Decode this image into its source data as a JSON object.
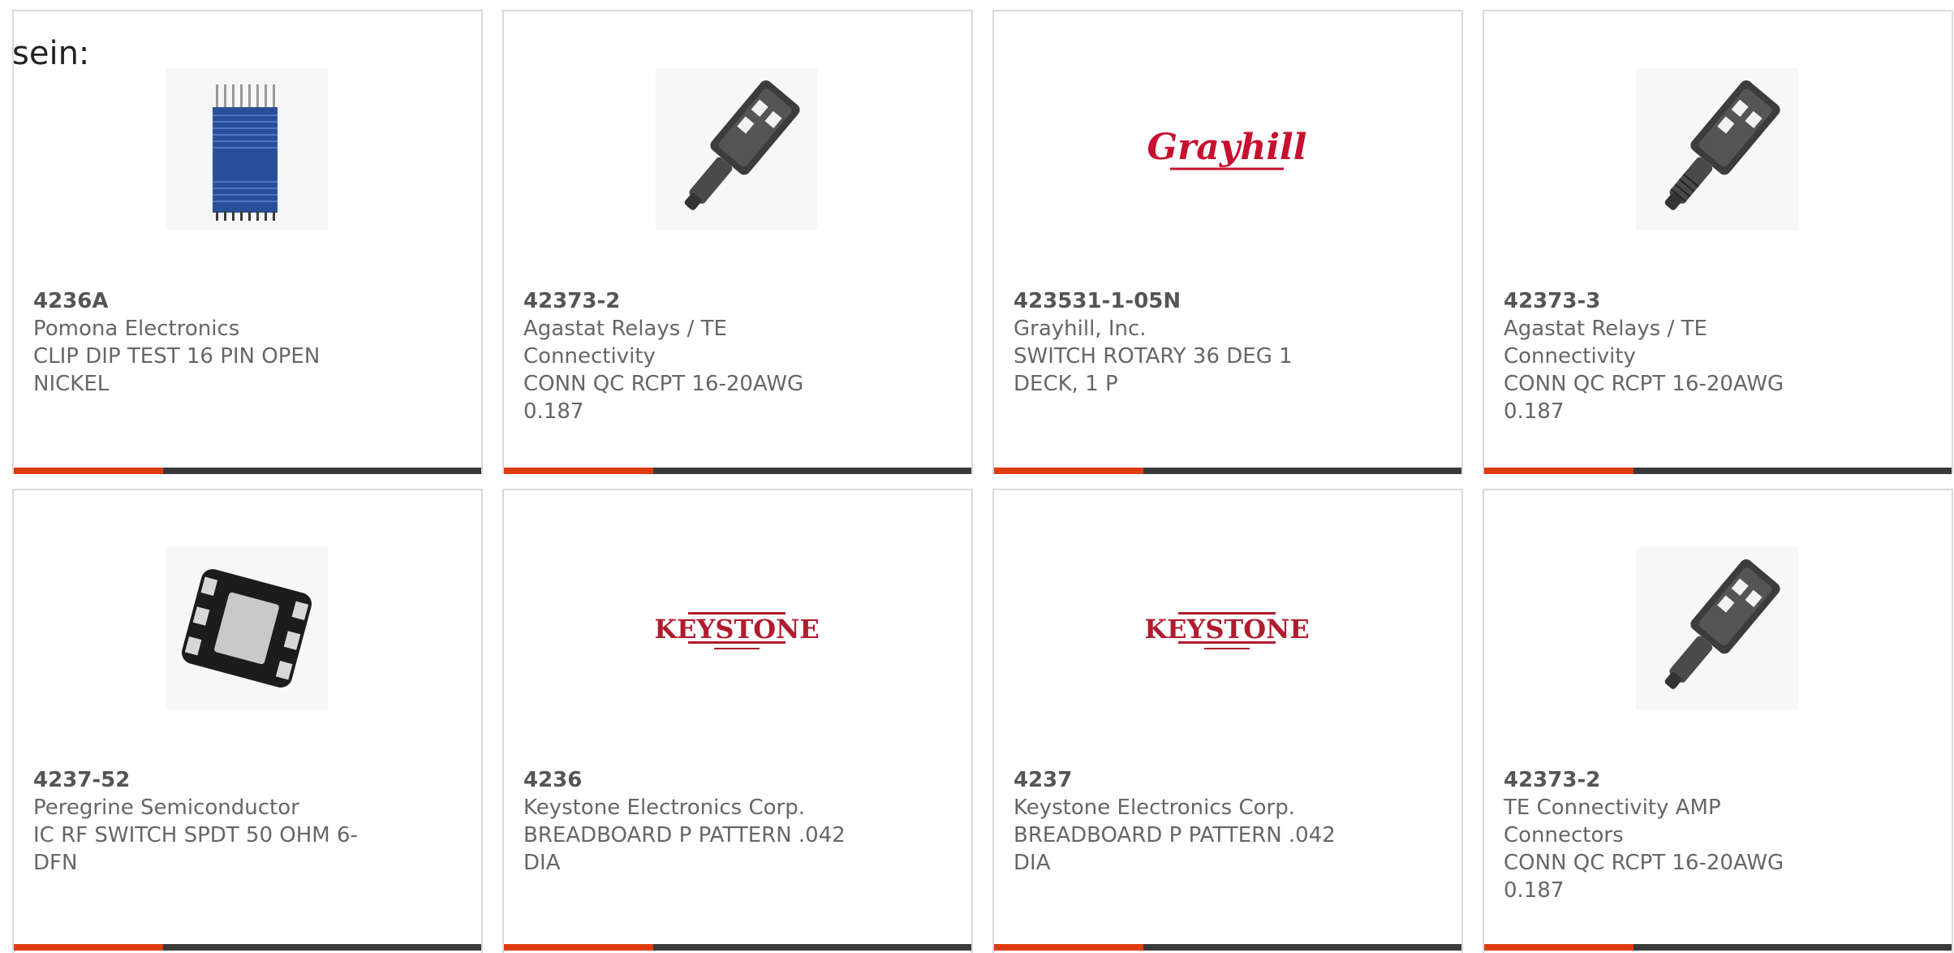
{
  "intro_text": "sein:",
  "colors": {
    "accent": "#e03c12",
    "bar_dark": "#3a3a3a",
    "text": "#666666"
  },
  "products": [
    {
      "part_number": "4236A",
      "manufacturer": "Pomona Electronics",
      "description": "CLIP DIP TEST 16 PIN OPEN NICKEL",
      "image": "dip-test-clip-icon"
    },
    {
      "part_number": "42373-2",
      "manufacturer": "Agastat Relays / TE Connectivity",
      "description": "CONN QC RCPT 16-20AWG 0.187",
      "image": "quick-connect-receptacle-icon"
    },
    {
      "part_number": "423531-1-05N",
      "manufacturer": "Grayhill, Inc.",
      "description": "SWITCH ROTARY 36 DEG 1 DECK, 1 P",
      "image": "grayhill-logo",
      "logo_text": "Grayhill"
    },
    {
      "part_number": "42373-3",
      "manufacturer": "Agastat Relays / TE Connectivity",
      "description": "CONN QC RCPT 16-20AWG 0.187",
      "image": "quick-connect-receptacle-icon"
    },
    {
      "part_number": "4237-52",
      "manufacturer": "Peregrine Semiconductor",
      "description": "IC RF SWITCH SPDT 50 OHM 6-DFN",
      "image": "dfn-chip-icon"
    },
    {
      "part_number": "4236",
      "manufacturer": "Keystone Electronics Corp.",
      "description": "BREADBOARD P PATTERN .042 DIA",
      "image": "keystone-logo",
      "logo_text": "KEYSTONE"
    },
    {
      "part_number": "4237",
      "manufacturer": "Keystone Electronics Corp.",
      "description": "BREADBOARD P PATTERN .042 DIA",
      "image": "keystone-logo",
      "logo_text": "KEYSTONE"
    },
    {
      "part_number": "42373-2",
      "manufacturer": "TE Connectivity AMP Connectors",
      "description": "CONN QC RCPT 16-20AWG 0.187",
      "image": "quick-connect-receptacle-icon"
    }
  ]
}
